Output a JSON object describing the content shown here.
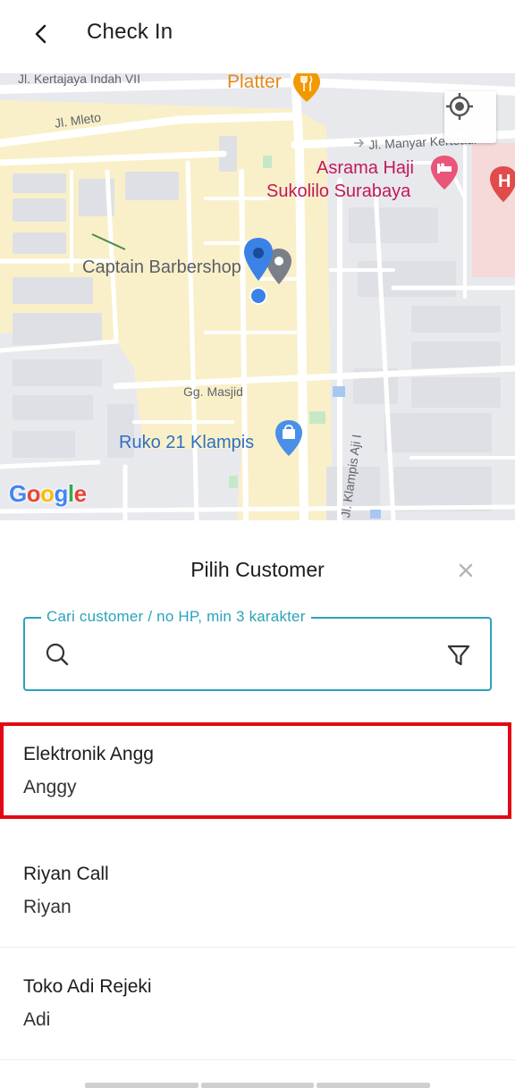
{
  "header": {
    "title": "Check In",
    "back_icon": "chevron-left-icon"
  },
  "map": {
    "streets": {
      "kertajaya": "Jl. Kertajaya Indah VII",
      "mleto": "Jl. Mleto",
      "manyar": "Jl. Manyar Kertoadi",
      "masjid": "Gg. Masjid",
      "klampis": "Jl. Klampis Aji I"
    },
    "pois": {
      "platter": "Platter",
      "asrama_line1": "Asrama Haji",
      "asrama_line2": "Sukolilo Surabaya",
      "captain": "Captain Barbershop",
      "ruko": "Ruko 21 Klampis",
      "hospital_letter": "H"
    },
    "logo": {
      "g1": "G",
      "o1": "o",
      "o2": "o",
      "g2": "g",
      "l": "l",
      "e": "e"
    },
    "locate_icon": "my-location-icon",
    "colors": {
      "pin": "#4285F4",
      "area": "#f8efc8",
      "road": "#ffffff",
      "block": "#e9eaee"
    }
  },
  "sheet": {
    "title": "Pilih Customer",
    "close_icon": "close-icon",
    "search": {
      "label": "Cari customer / no HP, min 3 karakter",
      "value": "",
      "placeholder": "",
      "accent": "#2aa3bd"
    },
    "customers": [
      {
        "name": "Elektronik Angg",
        "owner": "Anggy",
        "selected": true
      },
      {
        "name": "Riyan Call",
        "owner": "Riyan",
        "selected": false
      },
      {
        "name": "Toko Adi Rejeki",
        "owner": "Adi",
        "selected": false
      }
    ],
    "highlight_color": "#e30613"
  }
}
